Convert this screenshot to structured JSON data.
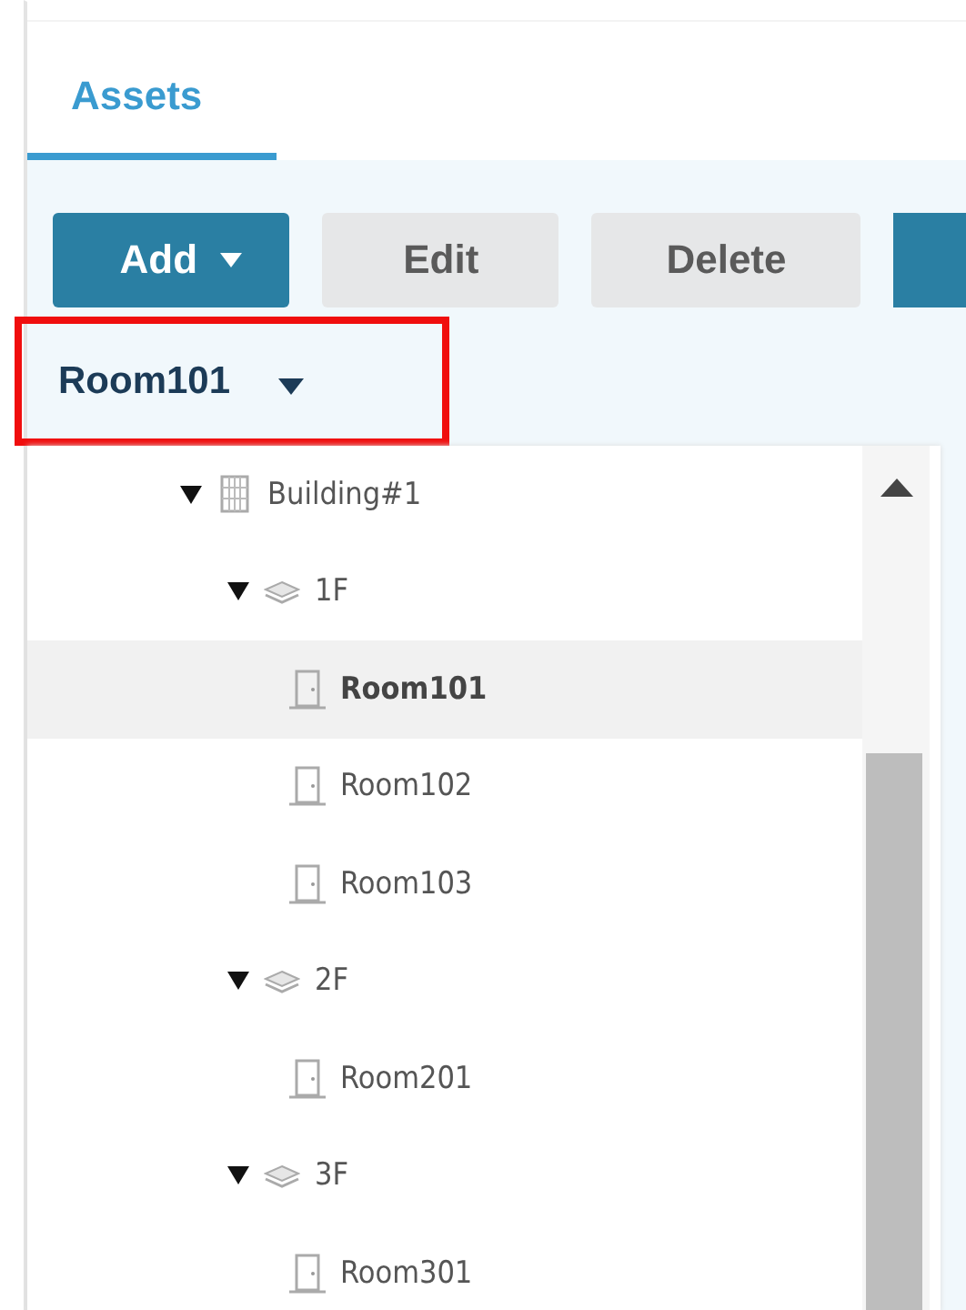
{
  "tabs": [
    {
      "label": "Assets",
      "selected": true
    }
  ],
  "toolbar": {
    "buttons": [
      {
        "label": "Add",
        "kind": "primary",
        "dropdown": true
      },
      {
        "label": "Edit",
        "kind": "secondary",
        "dropdown": false
      },
      {
        "label": "Delete",
        "kind": "secondary",
        "dropdown": false
      }
    ]
  },
  "location_selector": {
    "value": "Room101",
    "highlighted": true
  },
  "tree": {
    "items": [
      {
        "label": "Building#1",
        "kind": "building",
        "expanded": true,
        "selected": false,
        "children": [
          {
            "label": "1F",
            "kind": "floor",
            "expanded": true,
            "selected": false,
            "children": [
              {
                "label": "Room101",
                "kind": "room",
                "selected": true
              },
              {
                "label": "Room102",
                "kind": "room",
                "selected": false
              },
              {
                "label": "Room103",
                "kind": "room",
                "selected": false
              }
            ]
          },
          {
            "label": "2F",
            "kind": "floor",
            "expanded": true,
            "selected": false,
            "children": [
              {
                "label": "Room201",
                "kind": "room",
                "selected": false
              }
            ]
          },
          {
            "label": "3F",
            "kind": "floor",
            "expanded": true,
            "selected": false,
            "children": [
              {
                "label": "Room301",
                "kind": "room",
                "selected": false
              }
            ]
          }
        ]
      }
    ]
  }
}
